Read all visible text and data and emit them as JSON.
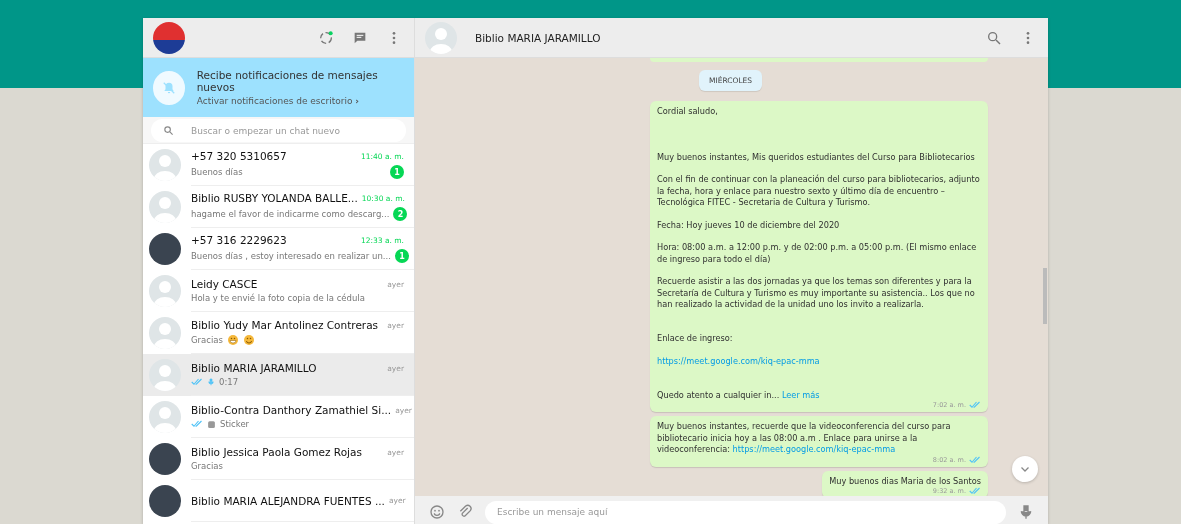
{
  "sidebar": {
    "header": {
      "avatar": {
        "kind": "logo"
      }
    },
    "notice": {
      "title": "Recibe notificaciones de mensajes nuevos",
      "action": "Activar notificaciones de escritorio",
      "chevron": "›"
    },
    "search": {
      "placeholder": "Buscar o empezar un chat nuevo"
    },
    "chats": [
      {
        "name": "+57 320 5310657",
        "time": "11:40 a. m.",
        "preview": "Buenos días",
        "unread": "1",
        "avatar": {
          "kind": "default"
        },
        "selected": false
      },
      {
        "name": "Biblio RUSBY YOLANDA BALLE...",
        "time": "10:30 a. m.",
        "preview": "hagame el favor de indicarme como descarg...",
        "unread": "2",
        "avatar": {
          "kind": "default"
        },
        "selected": false
      },
      {
        "name": "+57 316 2229623",
        "time": "12:33 a. m.",
        "preview": "Buenos días , estoy interesado en realizar un...",
        "unread": "1",
        "avatar": {
          "kind": "photo"
        },
        "selected": false
      },
      {
        "name": "Leidy CASCE",
        "time": "ayer",
        "preview": "Hola y te envié la foto copia de la cédula",
        "avatar": {
          "kind": "default"
        },
        "selected": false
      },
      {
        "name": "Biblio Yudy Mar Antolinez Contreras",
        "time": "ayer",
        "preview": "Gracias",
        "emojis": [
          {
            "kind": "grin"
          },
          {
            "kind": "smile"
          }
        ],
        "avatar": {
          "kind": "default"
        },
        "selected": false
      },
      {
        "name": "Biblio MARIA JARAMILLO",
        "time": "ayer",
        "preview": "0:17",
        "read_ticks": true,
        "media": {
          "kind": "voice"
        },
        "avatar": {
          "kind": "default"
        },
        "selected": true
      },
      {
        "name": "Biblio-Contra Danthory Zamathiel Si...",
        "time": "ayer",
        "preview": "Sticker",
        "read_ticks": true,
        "media": {
          "kind": "sticker"
        },
        "avatar": {
          "kind": "default"
        },
        "selected": false
      },
      {
        "name": "Biblio Jessica Paola Gomez Rojas",
        "time": "ayer",
        "preview": "Gracias",
        "avatar": {
          "kind": "photo"
        },
        "selected": false
      },
      {
        "name": "Biblio MARIA ALEJANDRA FUENTES ...",
        "time": "ayer",
        "avatar": {
          "kind": "photo"
        },
        "selected": false
      }
    ]
  },
  "chat": {
    "title": "Biblio MARIA JARAMILLO",
    "avatar": {
      "kind": "default"
    },
    "day": "MIÉRCOLES",
    "messages": [
      {
        "time": "7:02 a. m.",
        "read": true,
        "paragraphs": [
          {
            "kind": "text",
            "text": "Cordial saludo,"
          },
          {
            "kind": "blank"
          },
          {
            "kind": "blank"
          },
          {
            "kind": "text",
            "text": "Muy buenos instantes, Mis queridos estudiantes del Curso para Bibliotecarios"
          },
          {
            "kind": "text",
            "text": "Con el fin de continuar con la planeación del curso para bibliotecarios, adjunto la fecha, hora y enlace para nuestro sexto y último día de encuentro – Tecnológica FITEC - Secretaria de Cultura y Turismo."
          },
          {
            "kind": "text",
            "text": "Fecha: Hoy jueves 10 de diciembre del 2020"
          },
          {
            "kind": "text",
            "text": "Hora:  08:00 a.m. a 12:00 p.m. y de 02:00 p.m. a 05:00 p.m. (El mismo enlace de ingreso para todo el día)"
          },
          {
            "kind": "text",
            "text": "Recuerde asistir a las dos jornadas ya que los temas son diferentes y para la Secretaría de Cultura y Turismo es muy importante su asistencia.. Los que no han realizado la actividad de la unidad uno los invito a realizarla."
          },
          {
            "kind": "blank"
          },
          {
            "kind": "text",
            "text": "Enlace de ingreso:"
          },
          {
            "kind": "link",
            "text": "https://meet.google.com/kiq-epac-mma"
          },
          {
            "kind": "blank"
          },
          {
            "kind": "text",
            "text": "Quedo atento a cualquier in...",
            "more": "Leer más"
          }
        ]
      },
      {
        "time": "8:02 a. m.",
        "read": true,
        "paragraphs": [
          {
            "kind": "text",
            "text": "Muy buenos instantes, recuerde que la videoconferencia del curso para bibliotecario inicia hoy a las 08:00 a.m . Enlace para unirse a la videoconferencia:",
            "link": "https://meet.google.com/kiq-epac-mma"
          }
        ]
      },
      {
        "time": "9:32 a. m.",
        "read": true,
        "paragraphs": [
          {
            "kind": "text",
            "text": "Muy buenos dias Maria de los Santos"
          }
        ]
      }
    ],
    "composer": {
      "placeholder": "Escribe un mensaje aquí"
    }
  }
}
